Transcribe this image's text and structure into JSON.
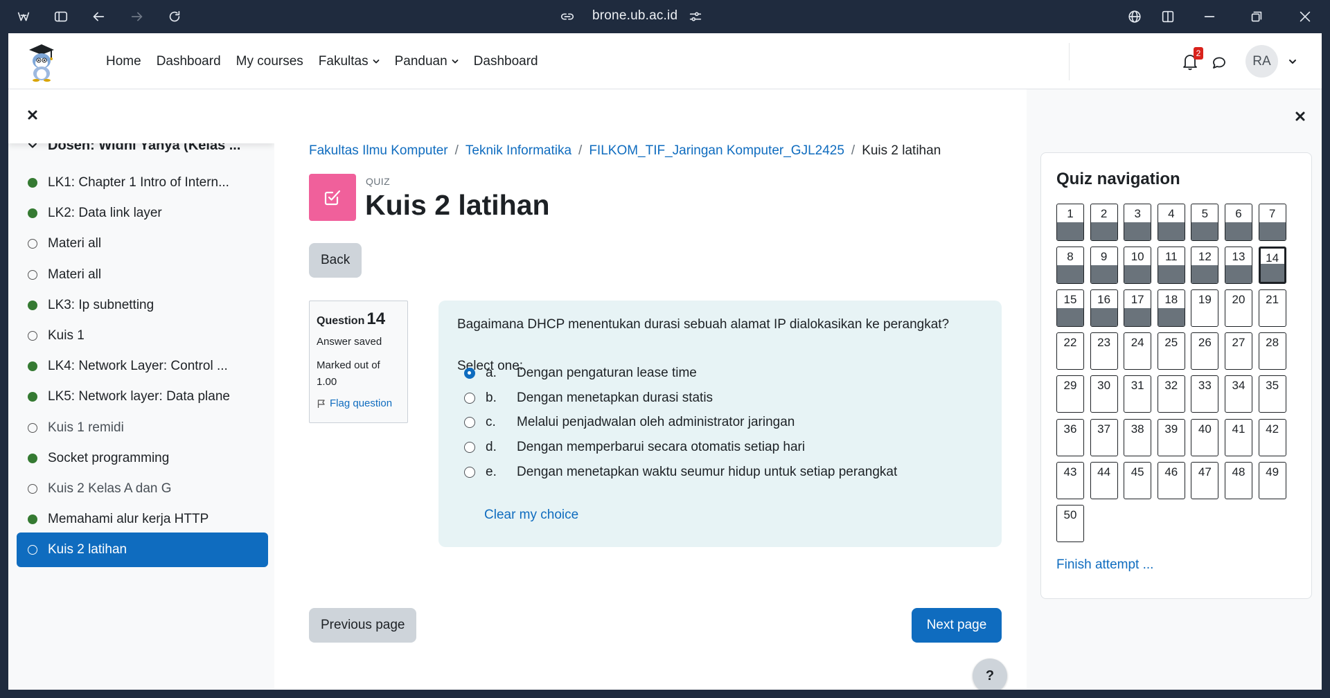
{
  "browser": {
    "url": "brone.ub.ac.id"
  },
  "navbar": {
    "links": [
      {
        "label": "Home",
        "has_caret": false
      },
      {
        "label": "Dashboard",
        "has_caret": false
      },
      {
        "label": "My courses",
        "has_caret": false
      },
      {
        "label": "Fakultas",
        "has_caret": true
      },
      {
        "label": "Panduan",
        "has_caret": true
      },
      {
        "label": "Dashboard",
        "has_caret": false
      }
    ],
    "notification_count": "2",
    "user_initials": "RA"
  },
  "course_index": {
    "section_title": "Dosen: Widhi Yahya (Kelas ...",
    "items": [
      {
        "label": "LK1: Chapter 1 Intro of Intern...",
        "status": "done"
      },
      {
        "label": "LK2: Data link layer",
        "status": "done"
      },
      {
        "label": "Materi all",
        "status": "todo"
      },
      {
        "label": "Materi all",
        "status": "todo"
      },
      {
        "label": "LK3: Ip subnetting",
        "status": "done"
      },
      {
        "label": "Kuis 1",
        "status": "todo"
      },
      {
        "label": "LK4: Network Layer: Control ...",
        "status": "done"
      },
      {
        "label": "LK5: Network layer: Data plane",
        "status": "done"
      },
      {
        "label": "Kuis 1 remidi",
        "status": "todo"
      },
      {
        "label": "Socket programming",
        "status": "done"
      },
      {
        "label": "Kuis 2 Kelas A dan G",
        "status": "todo"
      },
      {
        "label": "Memahami alur kerja HTTP",
        "status": "done"
      },
      {
        "label": "Kuis 2 latihan",
        "status": "todo",
        "active": true
      }
    ]
  },
  "breadcrumb": {
    "items": [
      "Fakultas Ilmu Komputer",
      "Teknik Informatika",
      "FILKOM_TIF_Jaringan Komputer_GJL2425"
    ],
    "current": "Kuis 2 latihan"
  },
  "header": {
    "kicker": "QUIZ",
    "title": "Kuis 2 latihan",
    "back_label": "Back"
  },
  "question_info": {
    "question_label": "Question",
    "number": "14",
    "state": "Answer saved",
    "marked": "Marked out of 1.00",
    "flag_label": "Flag question"
  },
  "question": {
    "text": "Bagaimana DHCP menentukan durasi sebuah alamat IP dialokasikan ke perangkat?",
    "select_label": "Select one:",
    "options": [
      {
        "letter": "a.",
        "text": "Dengan pengaturan lease time",
        "selected": true
      },
      {
        "letter": "b.",
        "text": "Dengan menetapkan durasi statis",
        "selected": false
      },
      {
        "letter": "c.",
        "text": "Melalui penjadwalan oleh administrator jaringan",
        "selected": false
      },
      {
        "letter": "d.",
        "text": "Dengan memperbarui secara otomatis setiap hari",
        "selected": false
      },
      {
        "letter": "e.",
        "text": "Dengan menetapkan waktu seumur hidup untuk setiap perangkat",
        "selected": false
      }
    ],
    "clear_label": "Clear my choice"
  },
  "navigation": {
    "prev_label": "Previous page",
    "next_label": "Next page",
    "help_label": "?"
  },
  "quiz_navigation": {
    "title": "Quiz navigation",
    "total_questions": 50,
    "answered_count": 18,
    "current_question": 14,
    "finish_label": "Finish attempt ..."
  },
  "colors": {
    "accent": "#0f6cbf",
    "quiz_icon": "#f0609b",
    "completed_dot": "#357a32",
    "answered_fill": "#6a737b",
    "question_bg": "#e7f3f5"
  }
}
